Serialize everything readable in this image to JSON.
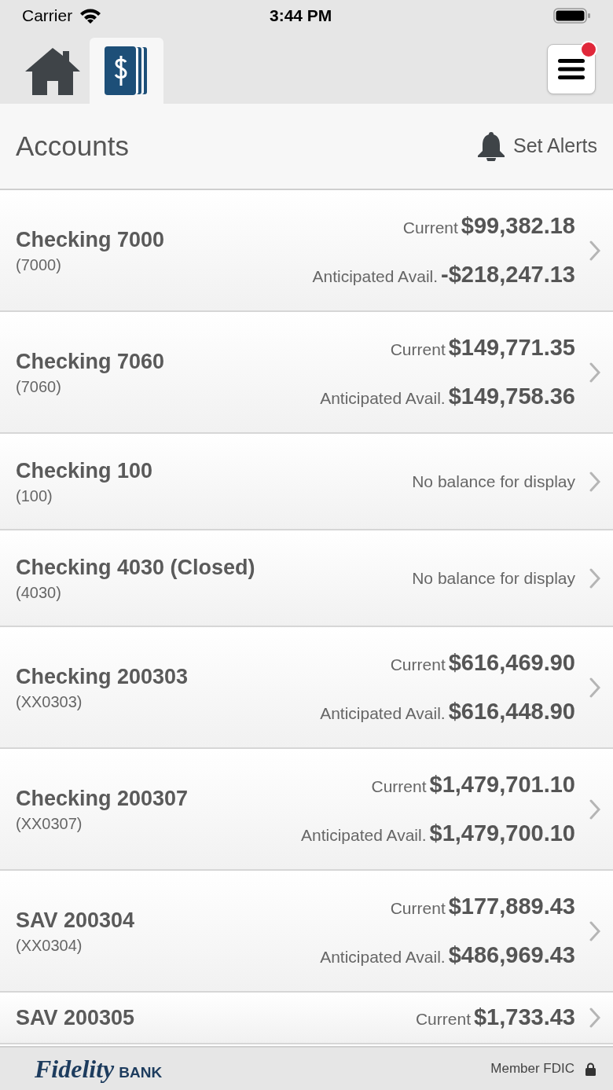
{
  "status_bar": {
    "carrier": "Carrier",
    "time": "3:44 PM"
  },
  "tabs": [
    {
      "kind": "home",
      "selected": false
    },
    {
      "kind": "accounts",
      "selected": true
    }
  ],
  "menu_button": {
    "notification": true
  },
  "header": {
    "title": "Accounts",
    "action": "Set Alerts"
  },
  "accounts": [
    {
      "name": "Checking 7000",
      "number": "(7000)",
      "balances": [
        {
          "label": "Current",
          "amount": "$99,382.18"
        },
        {
          "label": "Anticipated Avail.",
          "amount": "-$218,247.13"
        }
      ]
    },
    {
      "name": "Checking 7060",
      "number": "(7060)",
      "balances": [
        {
          "label": "Current",
          "amount": "$149,771.35"
        },
        {
          "label": "Anticipated Avail.",
          "amount": "$149,758.36"
        }
      ]
    },
    {
      "name": "Checking 100",
      "number": "(100)",
      "note": "No balance for display"
    },
    {
      "name": "Checking 4030 (Closed)",
      "number": "(4030)",
      "note": "No balance for display"
    },
    {
      "name": "Checking 200303",
      "number": "(XX0303)",
      "balances": [
        {
          "label": "Current",
          "amount": "$616,469.90"
        },
        {
          "label": "Anticipated Avail.",
          "amount": "$616,448.90"
        }
      ]
    },
    {
      "name": "Checking 200307",
      "number": "(XX0307)",
      "balances": [
        {
          "label": "Current",
          "amount": "$1,479,701.10"
        },
        {
          "label": "Anticipated Avail.",
          "amount": "$1,479,700.10"
        }
      ]
    },
    {
      "name": "SAV 200304",
      "number": "(XX0304)",
      "balances": [
        {
          "label": "Current",
          "amount": "$177,889.43"
        },
        {
          "label": "Anticipated Avail.",
          "amount": "$486,969.43"
        }
      ]
    },
    {
      "name": "SAV 200305",
      "balances": [
        {
          "label": "Current",
          "amount": "$1,733.43"
        }
      ]
    }
  ],
  "footer": {
    "logo_script": "Fidelity",
    "logo_word": "BANK",
    "note": "Member FDIC"
  }
}
